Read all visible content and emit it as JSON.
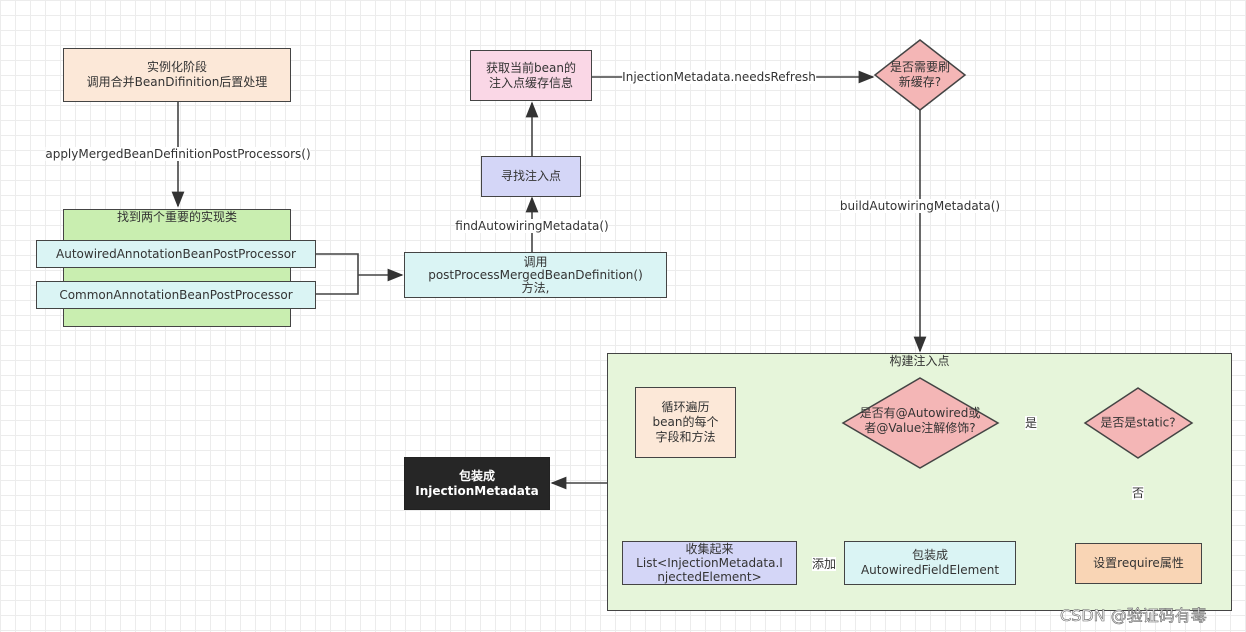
{
  "nodes": {
    "instantiate": {
      "line1": "实例化阶段",
      "line2": "调用合并BeanDifinition后置处理"
    },
    "find_impls": {
      "title": "找到两个重要的实现类"
    },
    "autowired_processor": {
      "label": "AutowiredAnnotationBeanPostProcessor"
    },
    "common_processor": {
      "label": "CommonAnnotationBeanPostProcessor"
    },
    "call_method": {
      "line1": "调用",
      "line2": "postProcessMergedBeanDefinition()",
      "line3": "方法,"
    },
    "find_injection": {
      "label": "寻找注入点"
    },
    "get_cache": {
      "line1": "获取当前bean的",
      "line2": "注入点缓存信息"
    },
    "needs_refresh": {
      "line1": "是否需要刷",
      "line2": "新缓存?"
    },
    "build_container": {
      "title": "构建注入点"
    },
    "loop": {
      "line1": "循环遍历",
      "line2": "bean的每个",
      "line3": "字段和方法"
    },
    "has_annotation": {
      "line1": "是否有@Autowired或",
      "line2": "者@Value注解修饰?"
    },
    "is_static": {
      "label": "是否是static?"
    },
    "set_require": {
      "label": "设置require属性"
    },
    "wrap_field": {
      "line1": "包装成",
      "line2": "AutowiredFieldElement"
    },
    "collect": {
      "line1": "收集起来",
      "line2": "List<InjectionMetadata.I",
      "line3": "njectedElement>"
    },
    "wrap_metadata": {
      "line1": "包装成",
      "line2": "InjectionMetadata"
    }
  },
  "edges": {
    "apply": "applyMergedBeanDefinitionPostProcessors()",
    "find_autowiring": "findAutowiringMetadata()",
    "needs_refresh_call": "InjectionMetadata.needsRefresh",
    "build_autowiring": "buildAutowiringMetadata()",
    "yes": "是",
    "no": "否",
    "add": "添加"
  },
  "watermark": "CSDN @验证码有毒",
  "colors": {
    "orange": "#fce8d8",
    "green": "#c9eeb0",
    "cyan": "#daf4f4",
    "lavender": "#d4d6f7",
    "pink": "#fad7e6",
    "diamond": "#f4b6b6",
    "container": "#e6f5da",
    "peach": "#f9d5b5",
    "black": "#262626"
  }
}
